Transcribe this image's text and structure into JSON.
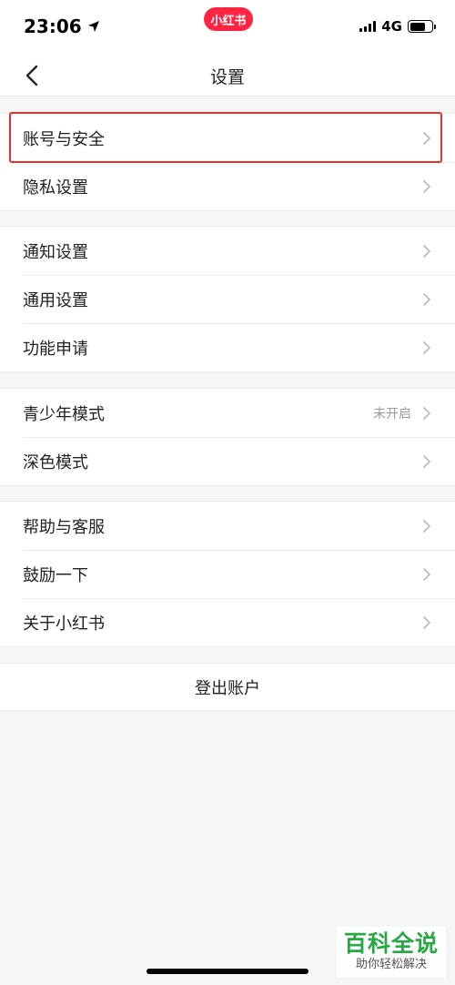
{
  "status_bar": {
    "time": "23:06",
    "app_badge": "小红书",
    "network": "4G"
  },
  "nav": {
    "title": "设置"
  },
  "groups": [
    {
      "items": [
        {
          "label": "账号与安全"
        },
        {
          "label": "隐私设置"
        }
      ]
    },
    {
      "items": [
        {
          "label": "通知设置"
        },
        {
          "label": "通用设置"
        },
        {
          "label": "功能申请"
        }
      ]
    },
    {
      "items": [
        {
          "label": "青少年模式",
          "value": "未开启"
        },
        {
          "label": "深色模式"
        }
      ]
    },
    {
      "items": [
        {
          "label": "帮助与客服"
        },
        {
          "label": "鼓励一下"
        },
        {
          "label": "关于小红书"
        }
      ]
    }
  ],
  "logout_label": "登出账户",
  "watermark": {
    "title": "百科全说",
    "subtitle": "助你轻松解决"
  },
  "colors": {
    "accent_red": "#ff2442",
    "highlight_border": "#e8302f",
    "watermark_green": "#27a844"
  }
}
